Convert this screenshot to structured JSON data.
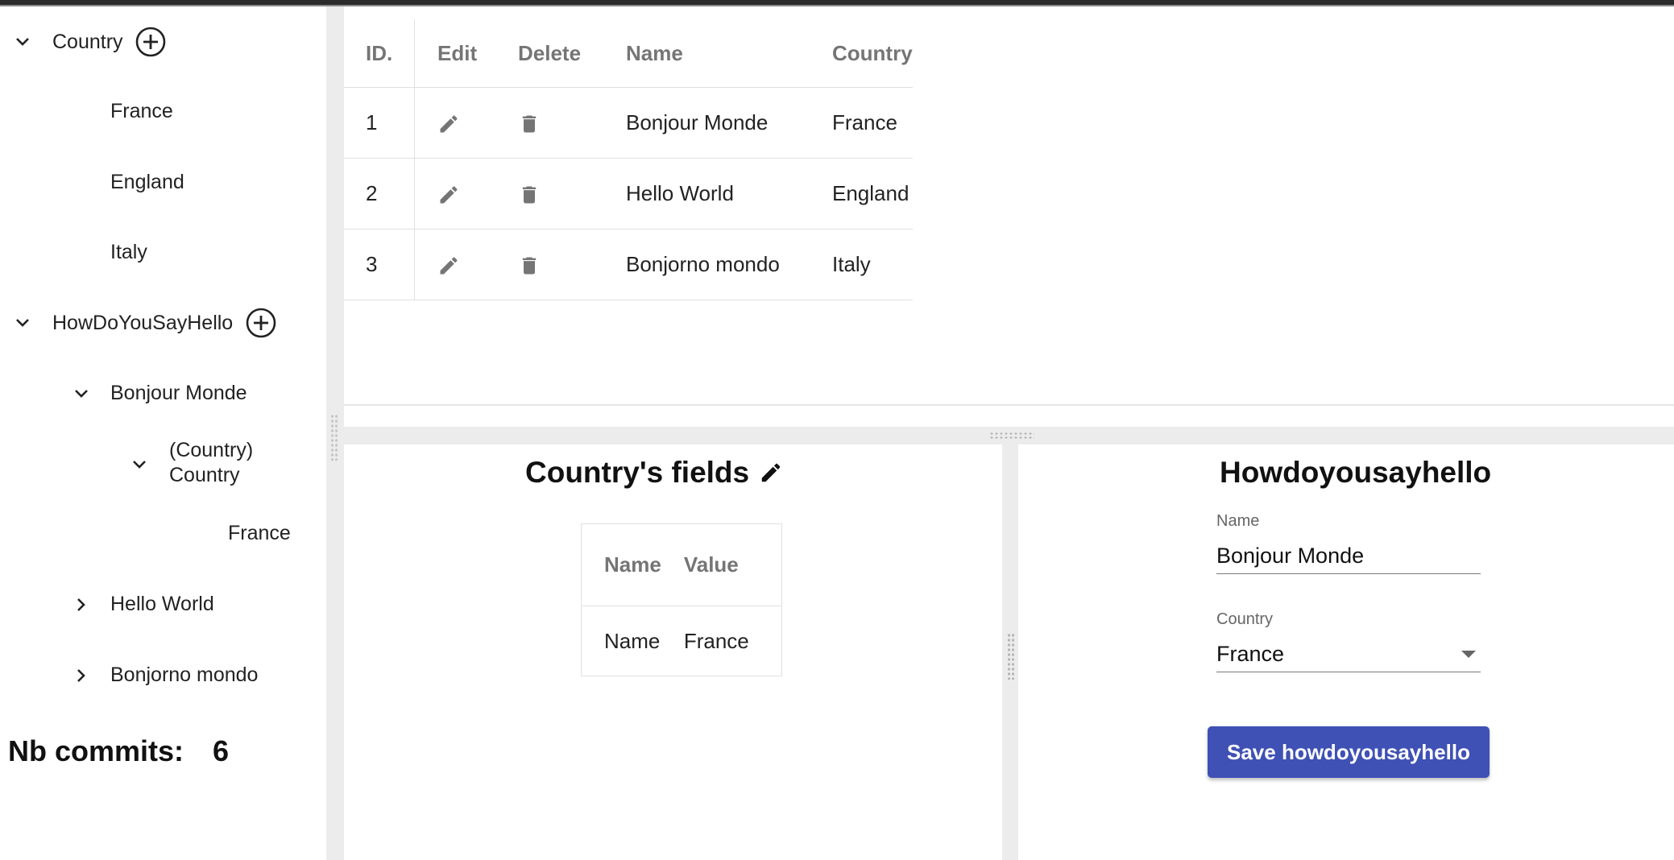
{
  "sidebar": {
    "country_group": {
      "label": "Country",
      "children": [
        "France",
        "England",
        "Italy"
      ]
    },
    "hello_group": {
      "label": "HowDoYouSayHello",
      "bonjour": {
        "label": "Bonjour Monde",
        "sub_line1": "(Country)",
        "sub_line2": "Country",
        "sub_child": "France"
      },
      "hello_world": "Hello World",
      "bonjorno": "Bonjorno mondo"
    },
    "commits_label": "Nb commits:",
    "commits_value": "6"
  },
  "table": {
    "headers": {
      "id": "ID.",
      "edit": "Edit",
      "delete": "Delete",
      "name": "Name",
      "country": "Country"
    },
    "rows": [
      {
        "id": "1",
        "name": "Bonjour Monde",
        "country": "France"
      },
      {
        "id": "2",
        "name": "Hello World",
        "country": "England"
      },
      {
        "id": "3",
        "name": "Bonjorno mondo",
        "country": "Italy"
      }
    ]
  },
  "fields_panel": {
    "title": "Country's fields",
    "headers": {
      "name": "Name",
      "value": "Value"
    },
    "rows": [
      {
        "name": "Name",
        "value": "France"
      }
    ]
  },
  "form": {
    "title": "Howdoyousayhello",
    "name_label": "Name",
    "name_value": "Bonjour Monde",
    "country_label": "Country",
    "country_value": "France",
    "save_label": "Save howdoyousayhello"
  },
  "colors": {
    "primary": "#3f51b5",
    "splitter": "#ececec",
    "header_text": "#757575"
  },
  "icons": {
    "expand": "chevron-down-icon",
    "collapse": "chevron-right-icon",
    "add": "add-circle-icon",
    "edit": "pencil-icon",
    "delete": "trash-icon"
  }
}
